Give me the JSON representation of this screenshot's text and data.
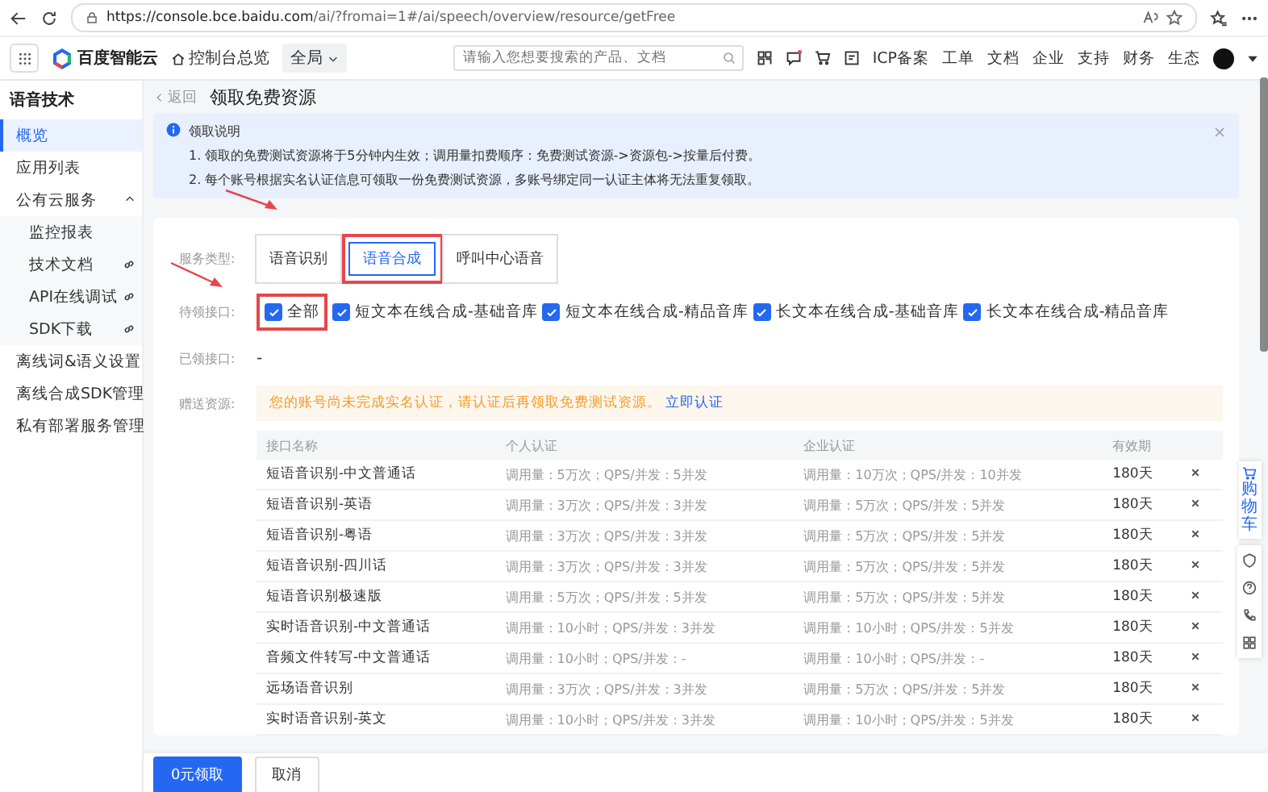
{
  "browser": {
    "url_host": "https://console.bce.baidu.com",
    "url_path": "/ai/?fromai=1#/ai/speech/overview/resource/getFree"
  },
  "topnav": {
    "logo": "百度智能云",
    "console": "控制台总览",
    "scope": "全局",
    "search": {
      "placeholder": "请输入您想要搜索的产品、文档"
    },
    "links": [
      "ICP备案",
      "工单",
      "文档",
      "企业",
      "支持",
      "财务",
      "生态"
    ]
  },
  "sidebar": {
    "title": "语音技术",
    "items": [
      {
        "label": "概览",
        "selected": true
      },
      {
        "label": "应用列表",
        "selected": false
      },
      {
        "label": "公有云服务",
        "selected": false,
        "expanded": true,
        "children": [
          {
            "label": "监控报表",
            "selected": false,
            "link": false
          },
          {
            "label": "技术文档",
            "selected": false,
            "link": true
          },
          {
            "label": "API在线调试",
            "selected": false,
            "link": true
          },
          {
            "label": "SDK下载",
            "selected": false,
            "link": true
          }
        ]
      },
      {
        "label": "离线词&语义设置",
        "selected": false
      },
      {
        "label": "离线合成SDK管理",
        "selected": false
      },
      {
        "label": "私有部署服务管理",
        "selected": false
      }
    ]
  },
  "page": {
    "back": "返回",
    "title": "领取免费资源"
  },
  "notice": {
    "title": "领取说明",
    "lines": [
      "1. 领取的免费测试资源将于5分钟内生效；调用量扣费顺序：免费测试资源->资源包->按量后付费。",
      "2. 每个账号根据实名认证信息可领取一份免费测试资源，多账号绑定同一认证主体将无法重复领取。"
    ]
  },
  "form": {
    "service_label": "服务类型:",
    "service_tabs": [
      {
        "label": "语音识别",
        "selected": false,
        "highlighted": false
      },
      {
        "label": "语音合成",
        "selected": true,
        "highlighted": true
      },
      {
        "label": "呼叫中心语音",
        "selected": false,
        "highlighted": false
      }
    ],
    "pending_label": "待领接口:",
    "pending": [
      {
        "label": "全部",
        "checked": true,
        "highlighted": true
      },
      {
        "label": "短文本在线合成-基础音库",
        "checked": true,
        "highlighted": false
      },
      {
        "label": "短文本在线合成-精品音库",
        "checked": true,
        "highlighted": false
      },
      {
        "label": "长文本在线合成-基础音库",
        "checked": true,
        "highlighted": false
      },
      {
        "label": "长文本在线合成-精品音库",
        "checked": true,
        "highlighted": false
      }
    ],
    "claimed_label": "已领接口:",
    "claimed": "-",
    "gift_label": "赠送资源:",
    "warning": "您的账号尚未完成实名认证，请认证后再领取免费测试资源。",
    "warning_link": "立即认证"
  },
  "table": {
    "columns": [
      "接口名称",
      "个人认证",
      "企业认证",
      "有效期"
    ],
    "rows": [
      [
        "短语音识别-中文普通话",
        "调用量：5万次；QPS/并发：5并发",
        "调用量：10万次；QPS/并发：10并发",
        "180天"
      ],
      [
        "短语音识别-英语",
        "调用量：3万次；QPS/并发：3并发",
        "调用量：5万次；QPS/并发：5并发",
        "180天"
      ],
      [
        "短语音识别-粤语",
        "调用量：3万次；QPS/并发：3并发",
        "调用量：5万次；QPS/并发：5并发",
        "180天"
      ],
      [
        "短语音识别-四川话",
        "调用量：3万次；QPS/并发：3并发",
        "调用量：5万次；QPS/并发：5并发",
        "180天"
      ],
      [
        "短语音识别极速版",
        "调用量：5万次；QPS/并发：5并发",
        "调用量：5万次；QPS/并发：5并发",
        "180天"
      ],
      [
        "实时语音识别-中文普通话",
        "调用量：10小时；QPS/并发：3并发",
        "调用量：10小时；QPS/并发：5并发",
        "180天"
      ],
      [
        "音频文件转写-中文普通话",
        "调用量：10小时；QPS/并发：-",
        "调用量：10小时；QPS/并发：-",
        "180天"
      ],
      [
        "远场语音识别",
        "调用量：3万次；QPS/并发：3并发",
        "调用量：5万次；QPS/并发：5并发",
        "180天"
      ],
      [
        "实时语音识别-英文",
        "调用量：10小时；QPS/并发：3并发",
        "调用量：10小时；QPS/并发：5并发",
        "180天"
      ]
    ]
  },
  "footer": {
    "buttons": [
      {
        "label": "0元领取",
        "kind": "primary"
      },
      {
        "label": "取消",
        "kind": "default"
      }
    ]
  },
  "floatbar": {
    "cart": "购物车"
  }
}
